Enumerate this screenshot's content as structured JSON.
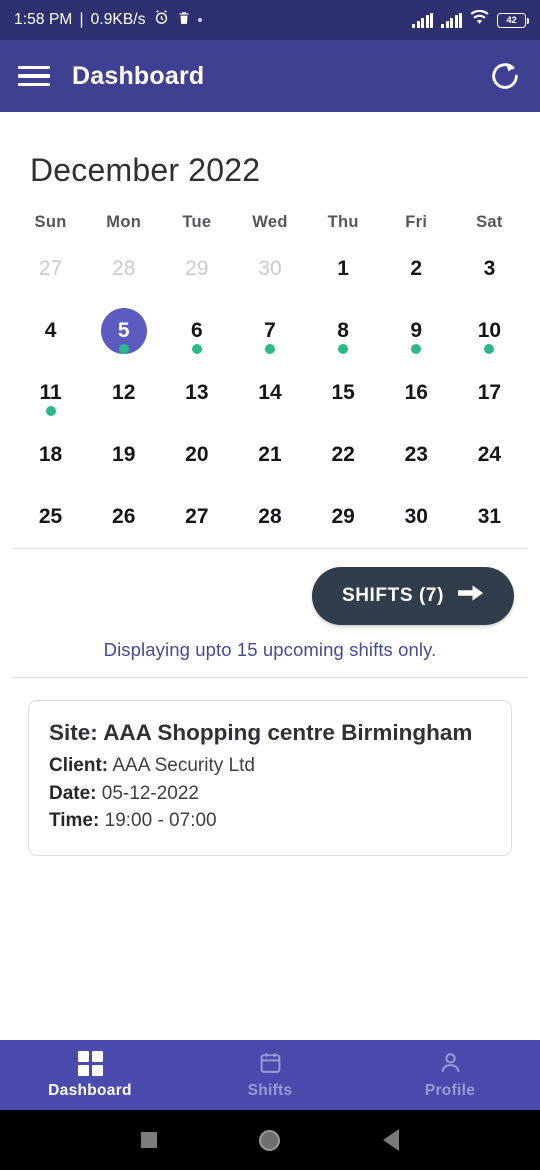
{
  "status_bar": {
    "time": "1:58 PM",
    "separator": "|",
    "net_speed": "0.9KB/s",
    "alarm_icon": "alarm-icon",
    "delete_icon": "trash-icon",
    "battery_level": "42",
    "signal_icon": "signal-bars-icon",
    "wifi_icon": "wifi-icon"
  },
  "app_bar": {
    "menu_icon": "hamburger-menu-icon",
    "title": "Dashboard",
    "refresh_icon": "refresh-icon"
  },
  "calendar": {
    "month_title": "December 2022",
    "weekdays": [
      "Sun",
      "Mon",
      "Tue",
      "Wed",
      "Thu",
      "Fri",
      "Sat"
    ],
    "weeks": [
      [
        {
          "label": "27",
          "muted": true,
          "selected": false,
          "dot": false
        },
        {
          "label": "28",
          "muted": true,
          "selected": false,
          "dot": false
        },
        {
          "label": "29",
          "muted": true,
          "selected": false,
          "dot": false
        },
        {
          "label": "30",
          "muted": true,
          "selected": false,
          "dot": false
        },
        {
          "label": "1",
          "muted": false,
          "selected": false,
          "dot": false
        },
        {
          "label": "2",
          "muted": false,
          "selected": false,
          "dot": false
        },
        {
          "label": "3",
          "muted": false,
          "selected": false,
          "dot": false
        }
      ],
      [
        {
          "label": "4",
          "muted": false,
          "selected": false,
          "dot": false
        },
        {
          "label": "5",
          "muted": false,
          "selected": true,
          "dot": true
        },
        {
          "label": "6",
          "muted": false,
          "selected": false,
          "dot": true
        },
        {
          "label": "7",
          "muted": false,
          "selected": false,
          "dot": true
        },
        {
          "label": "8",
          "muted": false,
          "selected": false,
          "dot": true
        },
        {
          "label": "9",
          "muted": false,
          "selected": false,
          "dot": true
        },
        {
          "label": "10",
          "muted": false,
          "selected": false,
          "dot": true
        }
      ],
      [
        {
          "label": "11",
          "muted": false,
          "selected": false,
          "dot": true
        },
        {
          "label": "12",
          "muted": false,
          "selected": false,
          "dot": false
        },
        {
          "label": "13",
          "muted": false,
          "selected": false,
          "dot": false
        },
        {
          "label": "14",
          "muted": false,
          "selected": false,
          "dot": false
        },
        {
          "label": "15",
          "muted": false,
          "selected": false,
          "dot": false
        },
        {
          "label": "16",
          "muted": false,
          "selected": false,
          "dot": false
        },
        {
          "label": "17",
          "muted": false,
          "selected": false,
          "dot": false
        }
      ],
      [
        {
          "label": "18",
          "muted": false,
          "selected": false,
          "dot": false
        },
        {
          "label": "19",
          "muted": false,
          "selected": false,
          "dot": false
        },
        {
          "label": "20",
          "muted": false,
          "selected": false,
          "dot": false
        },
        {
          "label": "21",
          "muted": false,
          "selected": false,
          "dot": false
        },
        {
          "label": "22",
          "muted": false,
          "selected": false,
          "dot": false
        },
        {
          "label": "23",
          "muted": false,
          "selected": false,
          "dot": false
        },
        {
          "label": "24",
          "muted": false,
          "selected": false,
          "dot": false
        }
      ],
      [
        {
          "label": "25",
          "muted": false,
          "selected": false,
          "dot": false
        },
        {
          "label": "26",
          "muted": false,
          "selected": false,
          "dot": false
        },
        {
          "label": "27",
          "muted": false,
          "selected": false,
          "dot": false
        },
        {
          "label": "28",
          "muted": false,
          "selected": false,
          "dot": false
        },
        {
          "label": "29",
          "muted": false,
          "selected": false,
          "dot": false
        },
        {
          "label": "30",
          "muted": false,
          "selected": false,
          "dot": false
        },
        {
          "label": "31",
          "muted": false,
          "selected": false,
          "dot": false
        }
      ]
    ]
  },
  "shifts_section": {
    "button_label": "SHIFTS (7)",
    "button_icon": "arrow-right-icon",
    "notice": "Displaying upto 15 upcoming shifts only."
  },
  "shift_card": {
    "site_label": "Site:",
    "site_value": "AAA Shopping centre Birmingham",
    "client_label": "Client:",
    "client_value": "AAA Security Ltd",
    "date_label": "Date:",
    "date_value": "05-12-2022",
    "time_label": "Time:",
    "time_value": "19:00 - 07:00"
  },
  "bottom_nav": {
    "items": [
      {
        "label": "Dashboard",
        "icon": "grid-dashboard-icon",
        "active": true
      },
      {
        "label": "Shifts",
        "icon": "calendar-icon",
        "active": false
      },
      {
        "label": "Profile",
        "icon": "person-icon",
        "active": false
      }
    ]
  },
  "android_nav": {
    "recents_icon": "square-recents-icon",
    "home_icon": "circle-home-icon",
    "back_icon": "triangle-back-icon"
  },
  "colors": {
    "status_bar": "#2e3070",
    "app_bar": "#404093",
    "selected_day": "#5b5bc0",
    "event_dot": "#2bb98a",
    "shifts_button": "#323d4c",
    "notice_text": "#454a9b",
    "bottom_nav": "#4b4bae"
  }
}
